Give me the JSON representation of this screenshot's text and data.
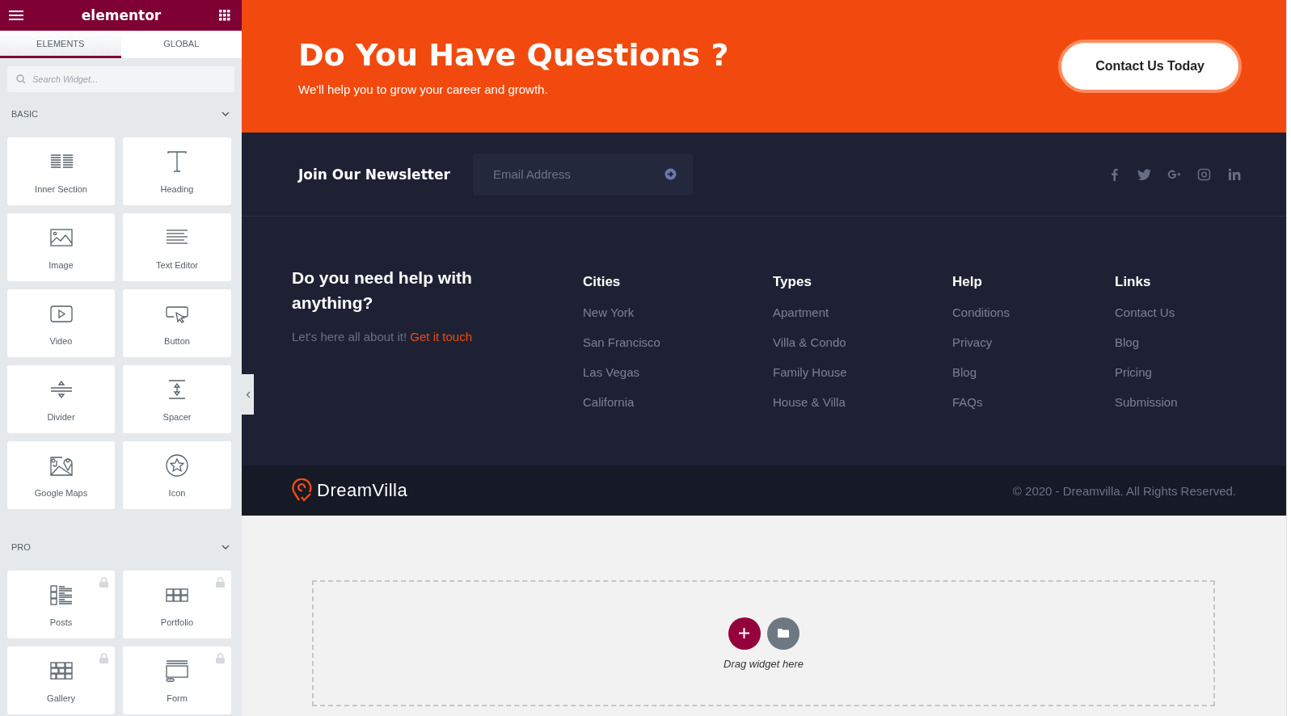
{
  "editor": {
    "brand": "elementor",
    "tabs": [
      {
        "label": "ELEMENTS",
        "selected": true
      },
      {
        "label": "GLOBAL",
        "selected": false
      }
    ],
    "search": {
      "placeholder": "Search Widget..."
    },
    "sections": [
      {
        "title": "BASIC",
        "expanded": true,
        "widgets": [
          {
            "kind": "inner-section",
            "label": "Inner Section",
            "locked": false
          },
          {
            "kind": "heading",
            "label": "Heading",
            "locked": false
          },
          {
            "kind": "image",
            "label": "Image",
            "locked": false
          },
          {
            "kind": "text-editor",
            "label": "Text Editor",
            "locked": false
          },
          {
            "kind": "video",
            "label": "Video",
            "locked": false
          },
          {
            "kind": "button",
            "label": "Button",
            "locked": false
          },
          {
            "kind": "divider",
            "label": "Divider",
            "locked": false
          },
          {
            "kind": "spacer",
            "label": "Spacer",
            "locked": false
          },
          {
            "kind": "google-maps",
            "label": "Google Maps",
            "locked": false
          },
          {
            "kind": "icon",
            "label": "Icon",
            "locked": false
          }
        ]
      },
      {
        "title": "PRO",
        "expanded": true,
        "widgets": [
          {
            "kind": "posts",
            "label": "Posts",
            "locked": true
          },
          {
            "kind": "portfolio",
            "label": "Portfolio",
            "locked": true
          },
          {
            "kind": "gallery",
            "label": "Gallery",
            "locked": true
          },
          {
            "kind": "form",
            "label": "Form",
            "locked": true
          }
        ]
      }
    ]
  },
  "cta": {
    "title": "Do You Have Questions ?",
    "subtitle": "We'll help you to grow your career and growth.",
    "button": "Contact Us Today"
  },
  "newsletter": {
    "title": "Join Our Newsletter",
    "placeholder": "Email Address",
    "socials": [
      {
        "kind": "facebook"
      },
      {
        "kind": "twitter"
      },
      {
        "kind": "google-plus"
      },
      {
        "kind": "instagram"
      },
      {
        "kind": "linkedin"
      }
    ]
  },
  "footer": {
    "help_title": "Do you need help with anything?",
    "help_text": "Let's here all about it!",
    "help_link": "Get it touch",
    "columns": [
      {
        "title": "Cities",
        "links": [
          "New York",
          "San Francisco",
          "Las Vegas",
          "California"
        ]
      },
      {
        "title": "Types",
        "links": [
          "Apartment",
          "Villa & Condo",
          "Family House",
          "House & Villa"
        ]
      },
      {
        "title": "Help",
        "links": [
          "Conditions",
          "Privacy",
          "Blog",
          "FAQs"
        ]
      },
      {
        "title": "Links",
        "links": [
          "Contact Us",
          "Blog",
          "Pricing",
          "Submission"
        ]
      }
    ]
  },
  "bottom": {
    "logo": "DreamVilla",
    "copyright": "© 2020 - Dreamvilla. All Rights Reserved."
  },
  "dropzone": {
    "hint": "Drag widget here"
  }
}
